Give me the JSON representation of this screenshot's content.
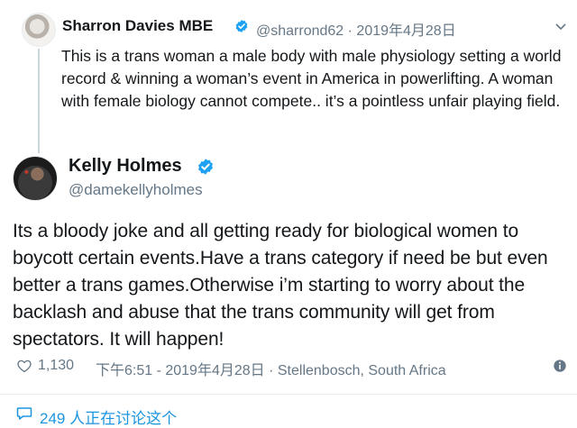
{
  "parent_tweet": {
    "name": "Sharron Davies MBE",
    "handle": "@sharrond62",
    "date": "· 2019年4月28日",
    "text": "This is a trans woman a male body with male physiology setting a world record & winning a woman’s event in America in powerlifting. A woman with female biology cannot compete.. it’s a pointless unfair playing field."
  },
  "main_tweet": {
    "name": "Kelly Holmes",
    "handle": "@damekellyholmes",
    "text": "Its a bloody joke and all getting ready for biological women to boycott certain events.Have a trans category if need be but even better a trans games.Otherwise i’m starting to worry about the backlash and abuse that the trans community will get from spectators. It will happen!",
    "likes": "1,130",
    "meta": "下午6:51 - 2019年4月28日 · Stellenbosch, South Africa"
  },
  "conversation": {
    "label": "249 人正在讨论这个"
  },
  "colors": {
    "verified": "#1da1f2",
    "link": "#1b95e0",
    "muted": "#657786",
    "text": "#14171a"
  }
}
